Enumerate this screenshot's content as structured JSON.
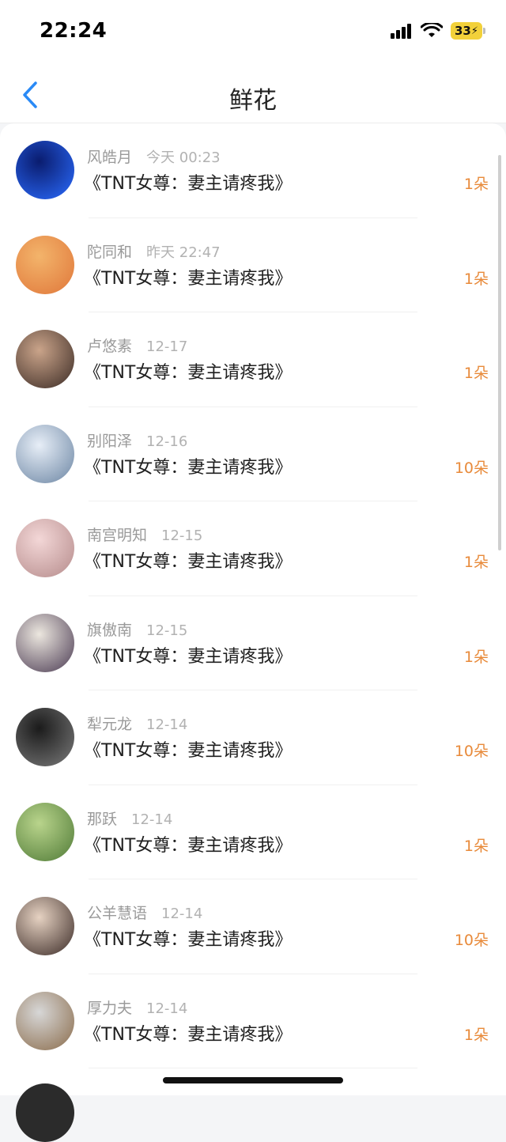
{
  "status_bar": {
    "time": "22:24",
    "battery": "33"
  },
  "header": {
    "title": "鲜花",
    "back_icon": "chevron-left-icon"
  },
  "list": {
    "items": [
      {
        "sender": "风皓月",
        "time": "今天 00:23",
        "book": "《TNT女尊：妻主请疼我》",
        "count": "1朵",
        "avatar_colors": [
          "#0a1c6e",
          "#2b6cff"
        ]
      },
      {
        "sender": "陀同和",
        "time": "昨天 22:47",
        "book": "《TNT女尊：妻主请疼我》",
        "count": "1朵",
        "avatar_colors": [
          "#f3b46b",
          "#e0773a"
        ]
      },
      {
        "sender": "卢悠素",
        "time": "12-17",
        "book": "《TNT女尊：妻主请疼我》",
        "count": "1朵",
        "avatar_colors": [
          "#caa48a",
          "#3a2a24"
        ]
      },
      {
        "sender": "别阳泽",
        "time": "12-16",
        "book": "《TNT女尊：妻主请疼我》",
        "count": "10朵",
        "avatar_colors": [
          "#e7eef7",
          "#6b85a3"
        ]
      },
      {
        "sender": "南宫明知",
        "time": "12-15",
        "book": "《TNT女尊：妻主请疼我》",
        "count": "1朵",
        "avatar_colors": [
          "#f3d7d7",
          "#b58b8b"
        ]
      },
      {
        "sender": "旗傲南",
        "time": "12-15",
        "book": "《TNT女尊：妻主请疼我》",
        "count": "1朵",
        "avatar_colors": [
          "#ece7df",
          "#4a3a52"
        ]
      },
      {
        "sender": "犁元龙",
        "time": "12-14",
        "book": "《TNT女尊：妻主请疼我》",
        "count": "10朵",
        "avatar_colors": [
          "#1b1b1b",
          "#7b7b7b"
        ]
      },
      {
        "sender": "那跃",
        "time": "12-14",
        "book": "《TNT女尊：妻主请疼我》",
        "count": "1朵",
        "avatar_colors": [
          "#b9d48c",
          "#4f7a36"
        ]
      },
      {
        "sender": "公羊慧语",
        "time": "12-14",
        "book": "《TNT女尊：妻主请疼我》",
        "count": "10朵",
        "avatar_colors": [
          "#e6d2c2",
          "#3a2a26"
        ]
      },
      {
        "sender": "厚力夫",
        "time": "12-14",
        "book": "《TNT女尊：妻主请疼我》",
        "count": "1朵",
        "avatar_colors": [
          "#d7d7d7",
          "#8a6b4a"
        ]
      }
    ]
  },
  "colors": {
    "accent": "#2a8af6",
    "count": "#e88a3a"
  }
}
